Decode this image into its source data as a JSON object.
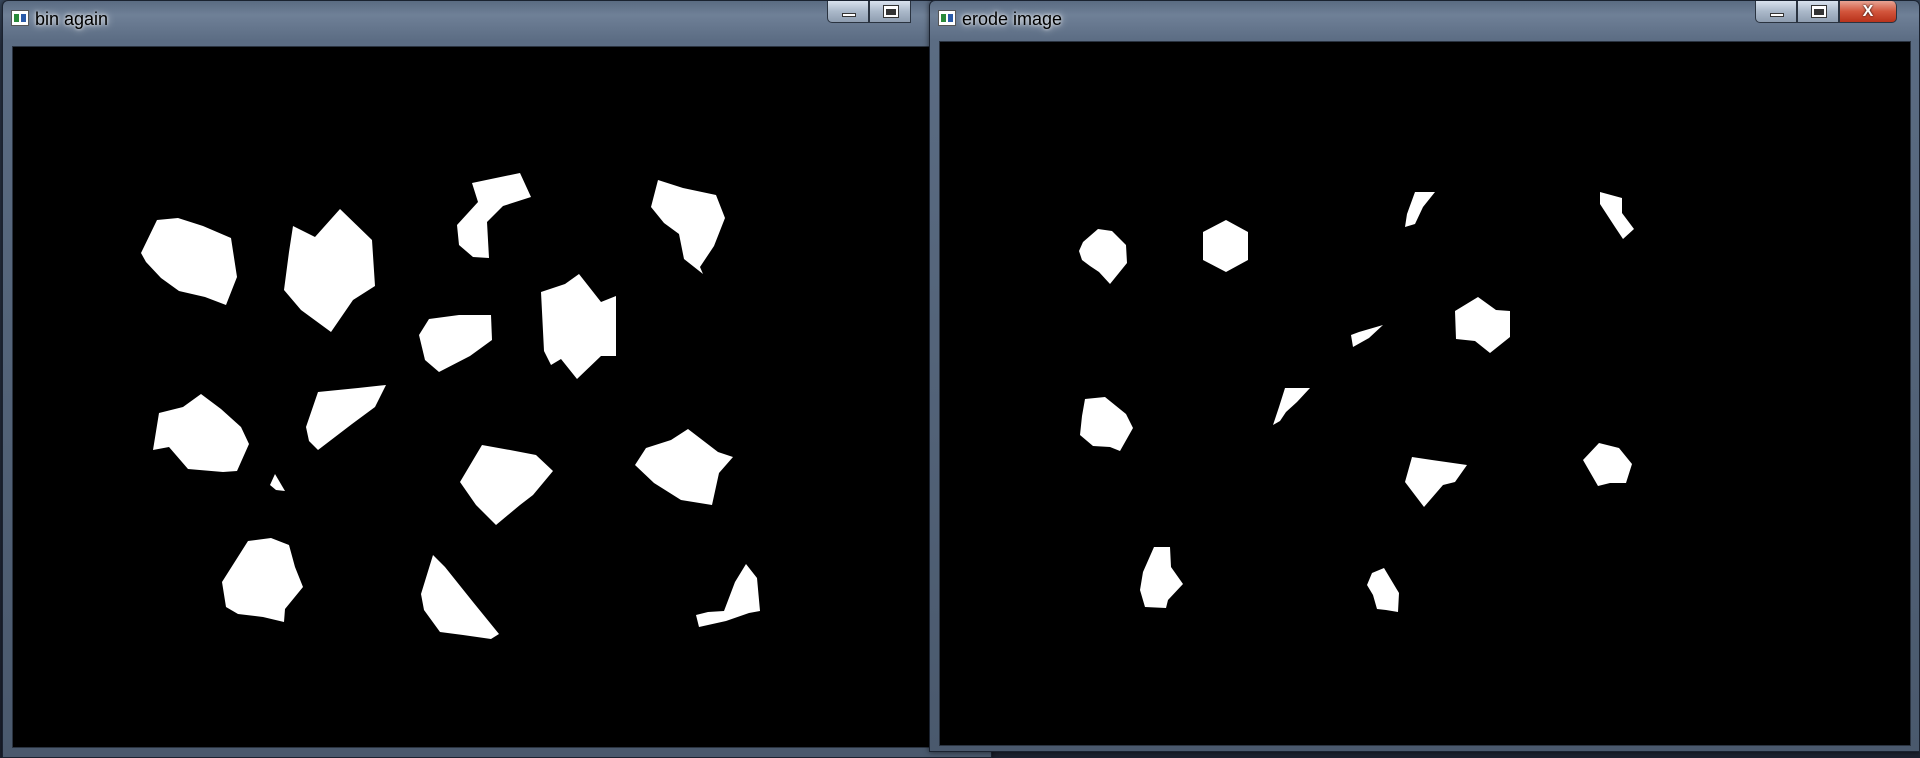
{
  "windows": [
    {
      "id": "bin_again",
      "title": "bin again",
      "icon": "window-app-icon"
    },
    {
      "id": "erode_image",
      "title": "erode image",
      "icon": "window-app-icon"
    }
  ],
  "controls": {
    "minimize": "minimize-icon",
    "maximize": "maximize-icon",
    "close_glyph": "X"
  },
  "colors": {
    "background": "#000000",
    "foreground": "#ffffff"
  }
}
